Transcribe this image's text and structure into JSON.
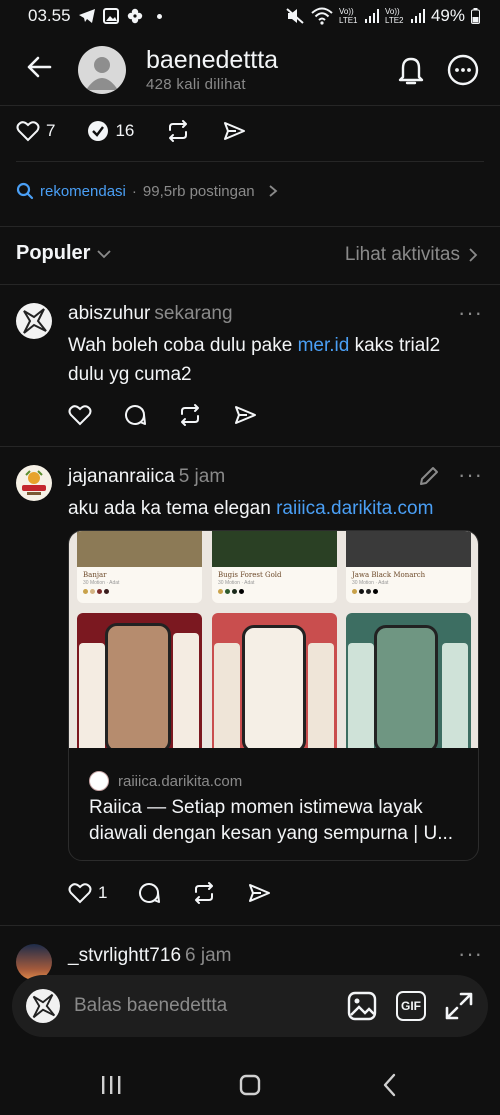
{
  "status_bar": {
    "time": "03.55",
    "battery": "49%",
    "network_labels": [
      "Vo)) LTE1",
      "Vo)) LTE2"
    ]
  },
  "header": {
    "username": "baenedettta",
    "views": "428 kali dilihat"
  },
  "stats": {
    "likes": "7",
    "reposts_label": "16"
  },
  "recommendation": {
    "tag": "rekomendasi",
    "separator": "·",
    "count": "99,5rb postingan"
  },
  "section": {
    "sort_label": "Populer",
    "activity_link": "Lihat aktivitas"
  },
  "posts": [
    {
      "user": "abiszuhur",
      "time": "sekarang",
      "text_before": "Wah boleh coba dulu pake ",
      "link": "mer.id",
      "text_after": " kaks trial2 dulu yg cuma2"
    },
    {
      "user": "jajananraiica",
      "time": "5 jam",
      "text_before": "aku ada ka tema elegan ",
      "link": "raiiica.darikita.com",
      "like_count": "1",
      "card": {
        "domain": "raiiica.darikita.com",
        "title": "Raiica — Setiap momen istimewa layak diawali dengan kesan yang sempurna | U...",
        "themes": [
          "Banjar",
          "Bugis Forest Gold",
          "Jawa Black Monarch"
        ],
        "theme_sub": "30 Motion · Adat"
      }
    },
    {
      "user": "_stvrlightt716",
      "time": "6 jam"
    }
  ],
  "reply": {
    "placeholder": "Balas baenedettta",
    "gif_label": "GIF"
  },
  "colors": {
    "background": "#101010",
    "link": "#4a9ff5",
    "muted": "#8a8a8a"
  }
}
